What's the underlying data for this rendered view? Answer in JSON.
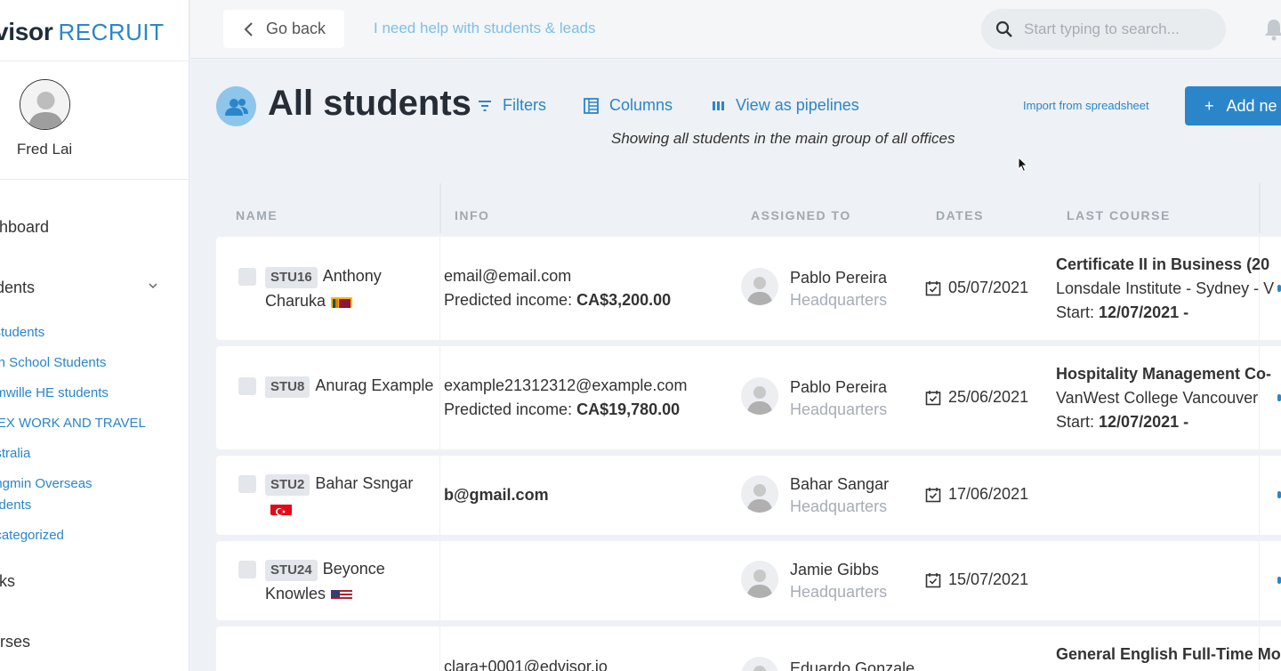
{
  "app": {
    "logo_part1": "visor",
    "logo_part2": "RECRUIT"
  },
  "user": {
    "name": "Fred Lai"
  },
  "sidebar": {
    "dashboard": "ashboard",
    "students": "tudents",
    "sub_items": [
      "l students",
      "igh School Students",
      "umwille HE students",
      "DEX WORK AND TRAVEL",
      "ustralia",
      "angmin Overseas tudents",
      "ncategorized"
    ],
    "tasks": "asks",
    "courses": "ourses"
  },
  "topbar": {
    "go_back": "Go back",
    "help": "I need help with students & leads",
    "search_placeholder": "Start typing to search..."
  },
  "header": {
    "title": "All students",
    "filters": "Filters",
    "columns": "Columns",
    "pipelines": "View as pipelines",
    "import": "Import from spreadsheet",
    "add": "Add ne",
    "subtitle": "Showing all students  in the main group  of all offices"
  },
  "table": {
    "columns": [
      "NAME",
      "INFO",
      "ASSIGNED TO",
      "DATES",
      "LAST COURSE"
    ],
    "rows": [
      {
        "id": "STU16",
        "name": "Anthony Charuka",
        "flag": "lk",
        "email": "email@email.com",
        "income_label": "Predicted income:",
        "income": "CA$3,200.00",
        "assignee": "Pablo Pereira",
        "office": "Headquarters",
        "date": "05/07/2021",
        "course_title": "Certificate II in Business (20",
        "course_school": "Lonsdale Institute - Sydney - V",
        "course_start_label": "Start:",
        "course_start": "12/07/2021 -"
      },
      {
        "id": "STU8",
        "name": "Anurag Example",
        "flag": "",
        "email": "example21312312@example.com",
        "income_label": "Predicted income:",
        "income": "CA$19,780.00",
        "assignee": "Pablo Pereira",
        "office": "Headquarters",
        "date": "25/06/2021",
        "course_title": "Hospitality Management Co-",
        "course_school": "VanWest College Vancouver",
        "course_start_label": "Start:",
        "course_start": "12/07/2021 -"
      },
      {
        "id": "STU2",
        "name": "Bahar Ssngar",
        "flag": "tr",
        "email": "b@gmail.com",
        "income_label": "",
        "income": "",
        "assignee": "Bahar Sangar",
        "office": "Headquarters",
        "date": "17/06/2021",
        "course_title": "",
        "course_school": "",
        "course_start_label": "",
        "course_start": ""
      },
      {
        "id": "STU24",
        "name": "Beyonce Knowles",
        "flag": "us",
        "email": "",
        "income_label": "",
        "income": "",
        "assignee": "Jamie Gibbs",
        "office": "Headquarters",
        "date": "15/07/2021",
        "course_title": "",
        "course_school": "",
        "course_start_label": "",
        "course_start": ""
      },
      {
        "id": "",
        "name": "",
        "flag": "",
        "email": "clara+0001@edvisor.io",
        "income_label": "",
        "income": "",
        "assignee": "Eduardo Gonzale",
        "office": "",
        "date": "",
        "course_title": "General English Full-Time Mo",
        "course_school": "",
        "course_start_label": "",
        "course_start": ""
      }
    ]
  },
  "colors": {
    "accent": "#2a86c9",
    "help_link": "#7fbfe6",
    "background": "#eef1f5"
  }
}
